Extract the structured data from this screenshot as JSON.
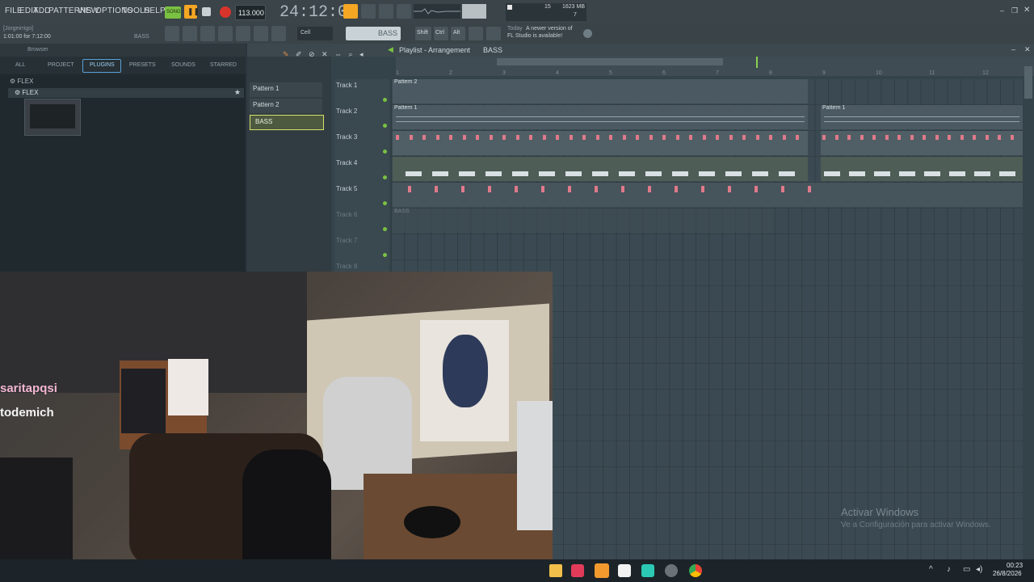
{
  "menu": [
    "FILE",
    "EDIT",
    "ADD",
    "PATTERNS",
    "VIEW",
    "OPTIONS",
    "TOOLS",
    "HELP"
  ],
  "transport": {
    "song_label": "SONG",
    "bpm": "113.000",
    "time": "24:12:01",
    "cpu_mem": "1623 MB",
    "cpu_val": "15",
    "poly": "7"
  },
  "hint": {
    "path": "[Jorgeirrigo]",
    "position": "1:01:00 for 7:12:00",
    "bass_label": "BASS"
  },
  "toolbar2": {
    "snap": "Cell",
    "pattern": "BASS",
    "shift": "Shift",
    "ctrl": "Ctrl",
    "alt": "Alt",
    "news_today": "Today",
    "news_text": "A newer version of",
    "news_text2": "FL Studio is available!"
  },
  "browser": {
    "title": "Browser",
    "tabs": [
      "ALL",
      "PROJECT",
      "PLUGINS",
      "PRESETS",
      "SOUNDS",
      "STARRED"
    ],
    "tree": [
      "FLEX",
      "FLEX"
    ]
  },
  "picker": [
    "Pattern 1",
    "Pattern 2",
    "BASS"
  ],
  "playlist": {
    "title": "Playlist - Arrangement",
    "breadcrumb": "BASS",
    "bars": [
      "1",
      "2",
      "3",
      "4",
      "5",
      "6",
      "7",
      "8",
      "9",
      "10",
      "11",
      "12"
    ],
    "tracks": [
      "Track 1",
      "Track 2",
      "Track 3",
      "Track 4",
      "Track 5",
      "Track 6",
      "Track 7",
      "Track 8"
    ],
    "clip_labels": [
      "Pattern 2",
      "Pattern 1",
      "Pattern 1",
      "BASS"
    ]
  },
  "overlay": {
    "chat1": "saritapqsi",
    "chat2": "todemich"
  },
  "watermark": {
    "line1": "Activar Windows",
    "line2": "Ve a Configuración para activar Windows."
  },
  "clock": {
    "time": "00:23",
    "date": "26/8/2026"
  },
  "colors": {
    "accent": "#f5a623",
    "record": "#d9342b",
    "grid": "#3b4a52",
    "clip": "#4a5960",
    "note": "#e07a8a"
  }
}
